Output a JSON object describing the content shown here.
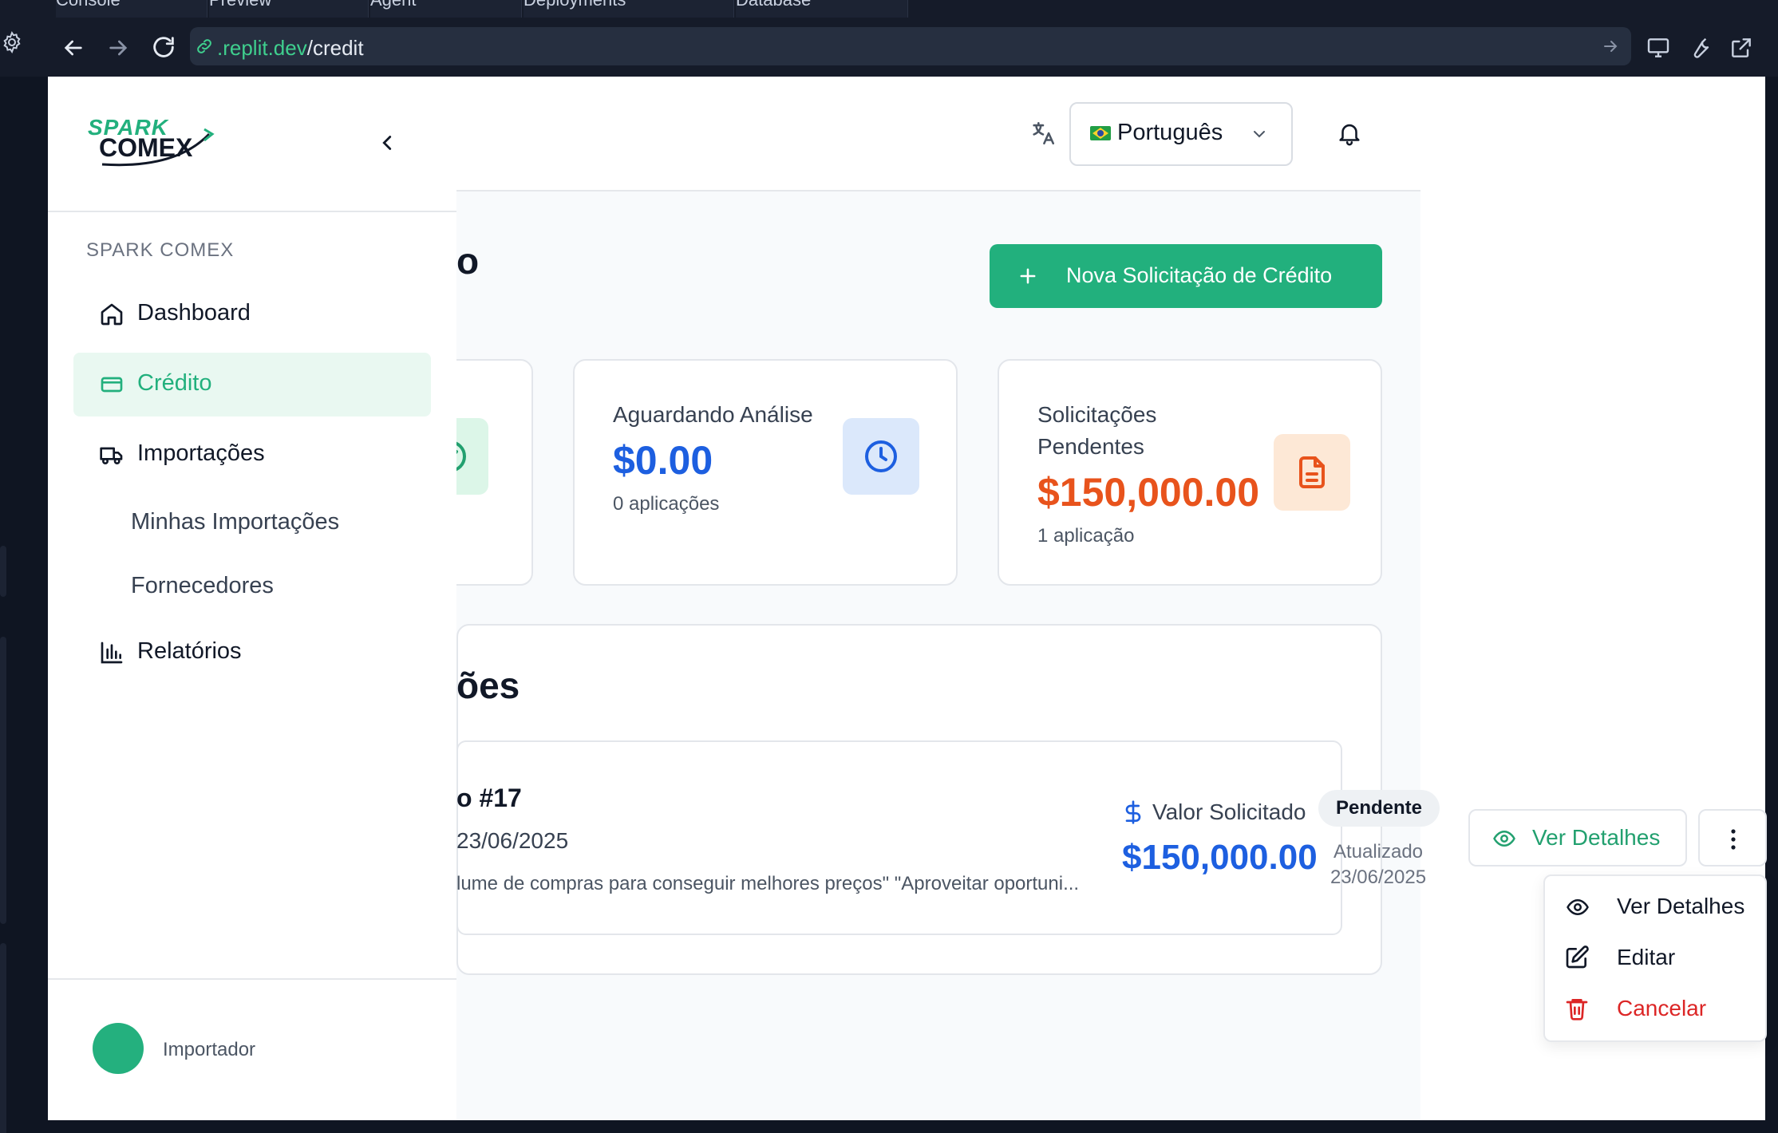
{
  "browser": {
    "tabs": [
      "Console",
      "Preview",
      "Agent",
      "Deployments",
      "Database"
    ],
    "url_domain": ".replit.dev",
    "url_path": "/credit"
  },
  "app": {
    "brand_top": "SPARK",
    "brand_bottom": "COMEX",
    "language": "Português",
    "page_title_fragment": "o",
    "new_button": "Nova Solicitação de Crédito",
    "colors": {
      "primary": "#22b07d",
      "blue": "#1d5fe0",
      "orange": "#e8531c",
      "danger": "#dc2626"
    }
  },
  "sidebar": {
    "section_label": "SPARK COMEX",
    "items": [
      {
        "label": "Dashboard",
        "icon": "home-icon"
      },
      {
        "label": "Crédito",
        "icon": "credit-card-icon"
      },
      {
        "label": "Importações",
        "icon": "truck-icon"
      },
      {
        "label": "Relatórios",
        "icon": "bar-chart-icon"
      }
    ],
    "subitems": [
      "Minhas Importações",
      "Fornecedores"
    ],
    "user_label": "Importador"
  },
  "stats": [
    {
      "label": "Aguardando Análise",
      "value": "$0.00",
      "sub": "0 aplicações"
    },
    {
      "label": "Solicitações Pendentes",
      "value": "$150,000.00",
      "sub": "1 aplicação"
    }
  ],
  "requests_section": {
    "title_fragment": "ões",
    "item": {
      "title_fragment": "o #17",
      "date_fragment": "23/06/2025",
      "description": "lume de compras para conseguir melhores preços\" \"Aproveitar oportuni...",
      "value_label": "Valor Solicitado",
      "value": "$150,000.00",
      "status": "Pendente",
      "updated_label": "Atualizado",
      "updated_date": "23/06/2025",
      "details_button": "Ver Detalhes"
    }
  },
  "dropdown_menu": {
    "items": [
      {
        "label": "Ver Detalhes",
        "icon": "eye-icon"
      },
      {
        "label": "Editar",
        "icon": "edit-icon"
      },
      {
        "label": "Cancelar",
        "icon": "trash-icon"
      }
    ]
  }
}
